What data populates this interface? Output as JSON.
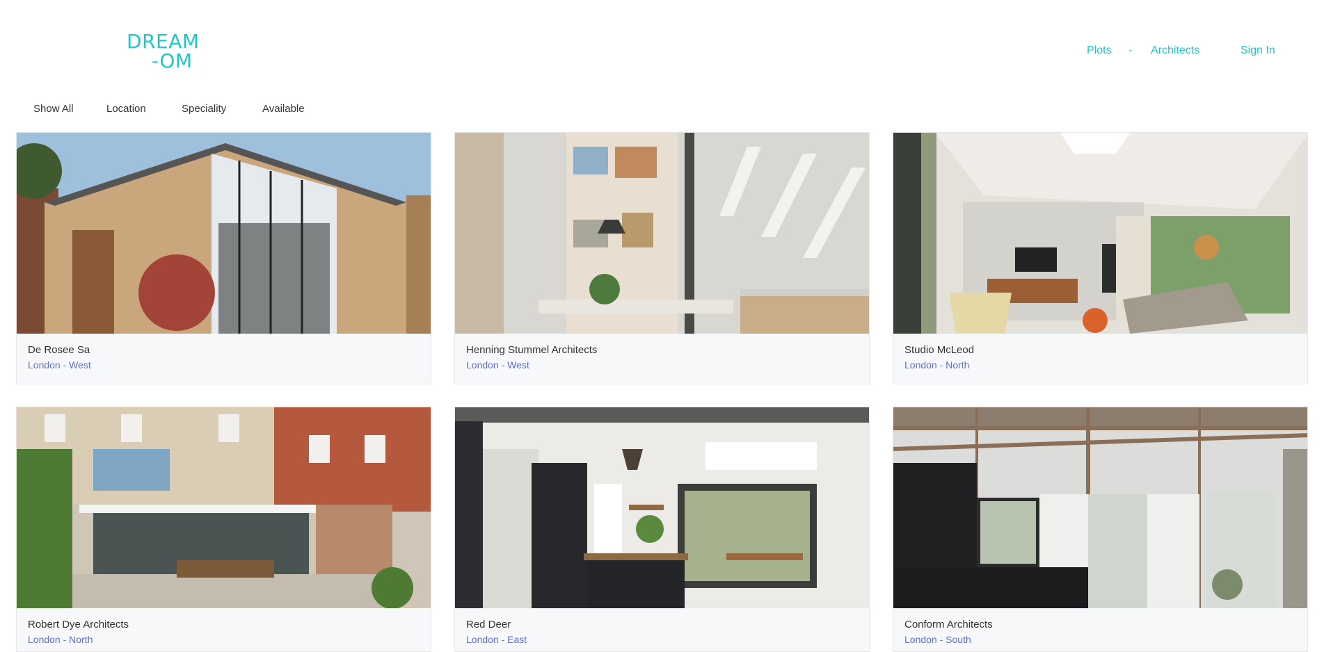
{
  "brand": {
    "line1": "DREAM",
    "line2": "-OM"
  },
  "nav": {
    "plots": "Plots",
    "separator": "-",
    "architects": "Architects",
    "sign_in": "Sign In"
  },
  "filters": [
    "Show All",
    "Location",
    "Speciality",
    "Available"
  ],
  "architects": [
    {
      "name": "De Rosee Sa",
      "location": "London - West"
    },
    {
      "name": "Henning Stummel Architects",
      "location": "London - West"
    },
    {
      "name": "Studio McLeod",
      "location": "London - North"
    },
    {
      "name": "Robert Dye Architects",
      "location": "London - North"
    },
    {
      "name": "Red Deer",
      "location": "London - East"
    },
    {
      "name": "Conform Architects",
      "location": "London - South"
    }
  ],
  "colors": {
    "accent": "#1fc8c8",
    "location_text": "#5b6fd8",
    "card_bg": "#f7f8fa"
  }
}
